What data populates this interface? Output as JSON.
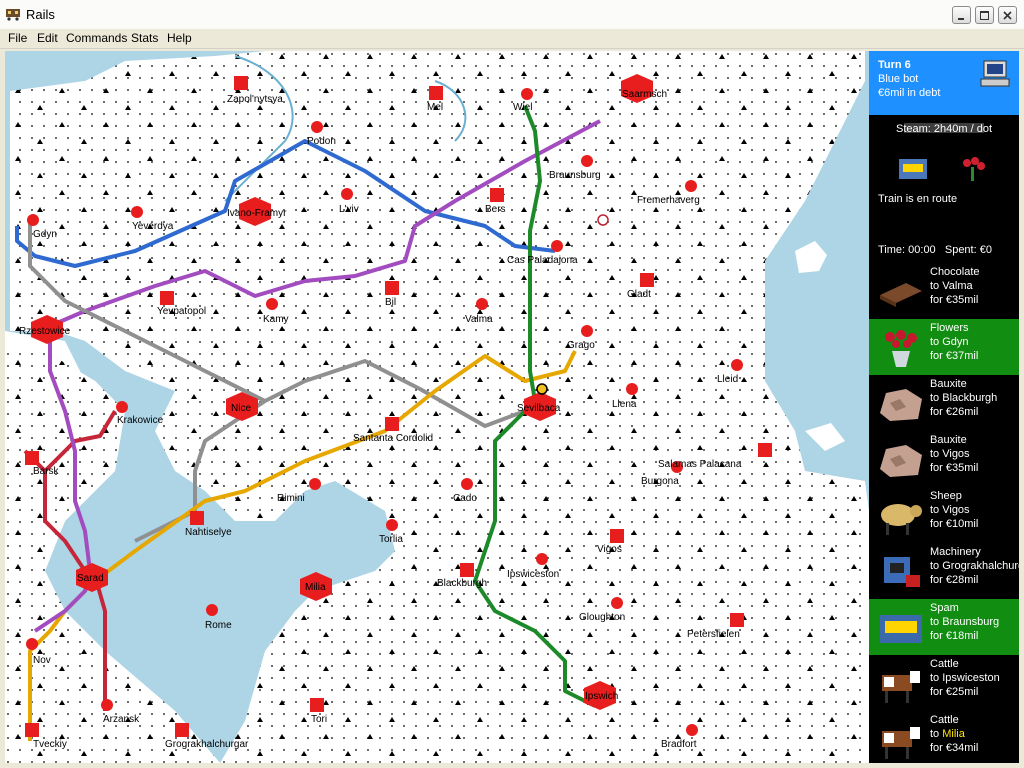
{
  "window": {
    "title": "Rails"
  },
  "menu": [
    "File",
    "Edit",
    "Commands",
    "Stats",
    "Help"
  ],
  "panel": {
    "turn": "Turn 6",
    "player": "Blue bot",
    "money": "€6mil in debt",
    "steam": "Steam: 2h40m / dot",
    "train_status": "Train is en route",
    "time": "Time: 00:00",
    "spent": "Spent: €0",
    "cargo_icons": [
      "spam-crate-icon",
      "flowers-icon"
    ],
    "demands": [
      {
        "cargo": "Chocolate",
        "to_prefix": "to ",
        "dest": "Valma",
        "pay": "for €35mil",
        "icon": "chocolate-icon"
      },
      {
        "cargo": "Flowers",
        "to_prefix": "to ",
        "dest": "Gdyn",
        "pay": "for €37mil",
        "icon": "flowers-icon"
      },
      {
        "cargo": "Bauxite",
        "to_prefix": "to ",
        "dest": "Blackburgh",
        "pay": "for €26mil",
        "icon": "bauxite-icon"
      },
      {
        "cargo": "Bauxite",
        "to_prefix": "to ",
        "dest": "Vigos",
        "pay": "for €35mil",
        "icon": "bauxite-icon"
      },
      {
        "cargo": "Sheep",
        "to_prefix": "to ",
        "dest": "Vigos",
        "pay": "for €10mil",
        "icon": "sheep-icon"
      },
      {
        "cargo": "Machinery",
        "to_prefix": "to ",
        "dest": "Grograkhalchurgar",
        "pay": "for €28mil",
        "icon": "machinery-icon"
      },
      {
        "cargo": "Spam",
        "to_prefix": "to ",
        "dest": "Braunsburg",
        "pay": "for €18mil",
        "icon": "spam-icon"
      },
      {
        "cargo": "Cattle",
        "to_prefix": "to ",
        "dest": "Ipswiceston",
        "pay": "for €25mil",
        "icon": "cattle-icon"
      },
      {
        "cargo": "Cattle",
        "to_prefix": "to ",
        "dest": "Milia",
        "pay": "for €34mil",
        "icon": "cattle-icon"
      }
    ]
  },
  "map": {
    "cities": [
      "Zapol'nytsya",
      "Mel",
      "Wiel",
      "Saarmsch",
      "Podon",
      "Braunsburg",
      "Fremerhaverg",
      "Gdyn",
      "Yeverdya",
      "Ivano-Framyr",
      "L'viv",
      "Bers",
      "Cas Paladajona",
      "Gladt",
      "Yevpatopol",
      "Kamy",
      "Bil",
      "Valma",
      "Rzestowice",
      "Grago",
      "Lleid",
      "Krakowice",
      "Nice",
      "Santanta Cordolid",
      "Sevilbaca",
      "Llena",
      "Barsk",
      "Rimini",
      "Cado",
      "Salamas Palacana",
      "Burgona",
      "Nahtiselye",
      "Torlia",
      "Vigos",
      "Sarad",
      "Blackburgh",
      "Ipswiceston",
      "Milia",
      "Rome",
      "Gloughton",
      "Petersfielen",
      "Nov",
      "Arzansk",
      "Tori",
      "Ipswich",
      "Tveckiy",
      "Grograkhalchurgar",
      "Bradfort"
    ]
  }
}
